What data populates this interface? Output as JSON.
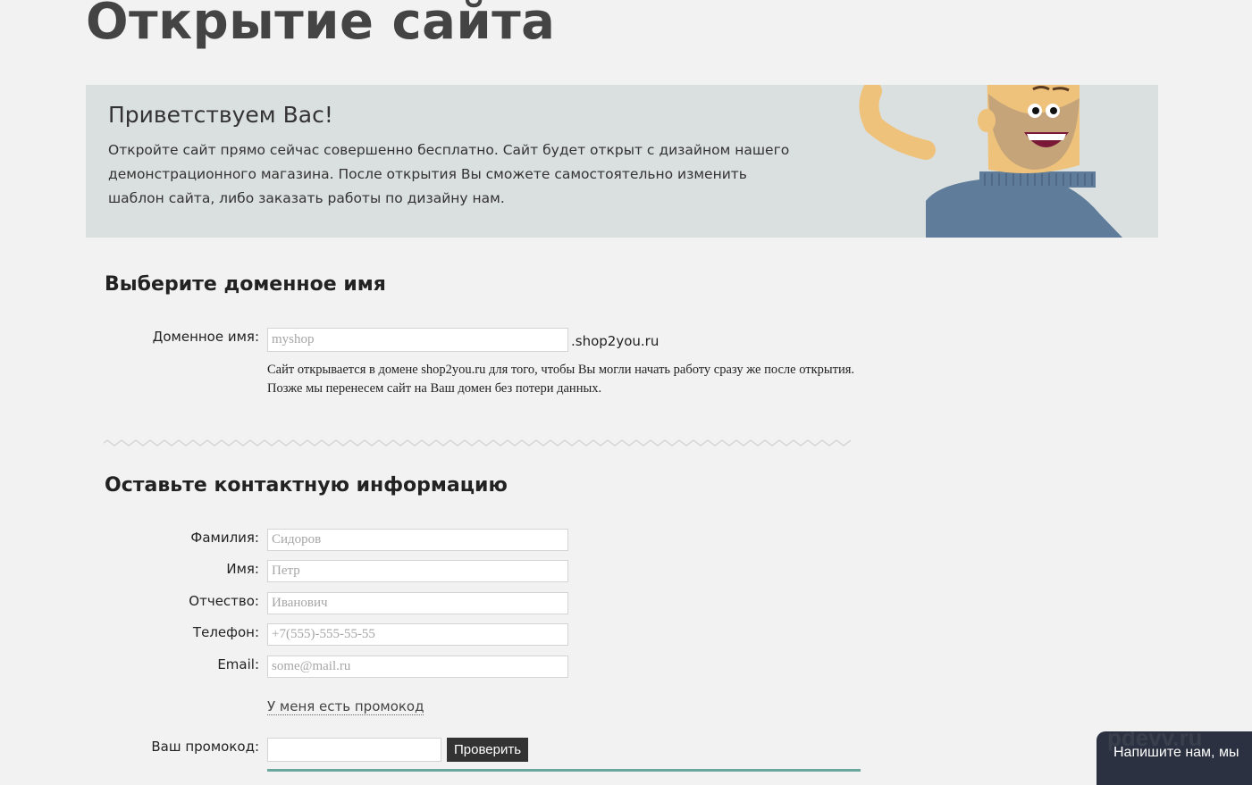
{
  "page": {
    "title": "Открытие сайта"
  },
  "welcome": {
    "heading": "Приветствуем Вас!",
    "text": "Откройте сайт прямо сейчас совершенно бесплатно. Сайт будет открыт с дизайном нашего демонстрационного магазина. После открытия Вы сможете самостоятельно изменить шаблон сайта, либо заказать работы по дизайну нам."
  },
  "domain_section": {
    "title": "Выберите доменное имя",
    "label": "Доменное имя:",
    "placeholder": "myshop",
    "value": "",
    "suffix": ".shop2you.ru",
    "hint": "Сайт открывается в домене shop2you.ru для того, чтобы Вы могли начать работу сразу же после открытия. Позже мы перенесем сайт на Ваш домен без потери данных."
  },
  "contact_section": {
    "title": "Оставьте контактную информацию",
    "fields": {
      "lastname": {
        "label": "Фамилия:",
        "placeholder": "Сидоров",
        "value": ""
      },
      "firstname": {
        "label": "Имя:",
        "placeholder": "Петр",
        "value": ""
      },
      "middlename": {
        "label": "Отчество:",
        "placeholder": "Иванович",
        "value": ""
      },
      "phone": {
        "label": "Телефон:",
        "placeholder": "+7(555)-555-55-55",
        "value": ""
      },
      "email": {
        "label": "Email:",
        "placeholder": "some@mail.ru",
        "value": ""
      }
    },
    "promo_link": "У меня есть промокод",
    "promo": {
      "label": "Ваш промокод:",
      "value": "",
      "button": "Проверить"
    }
  },
  "chat": {
    "label": "Напишите нам, мы",
    "watermark": "pdevv.ru"
  },
  "colors": {
    "background": "#f2f2f2",
    "banner": "#dae0df",
    "title": "#444444",
    "button": "#333333",
    "accent_line": "#6aa79d",
    "chat_bg": "#2b3140"
  }
}
